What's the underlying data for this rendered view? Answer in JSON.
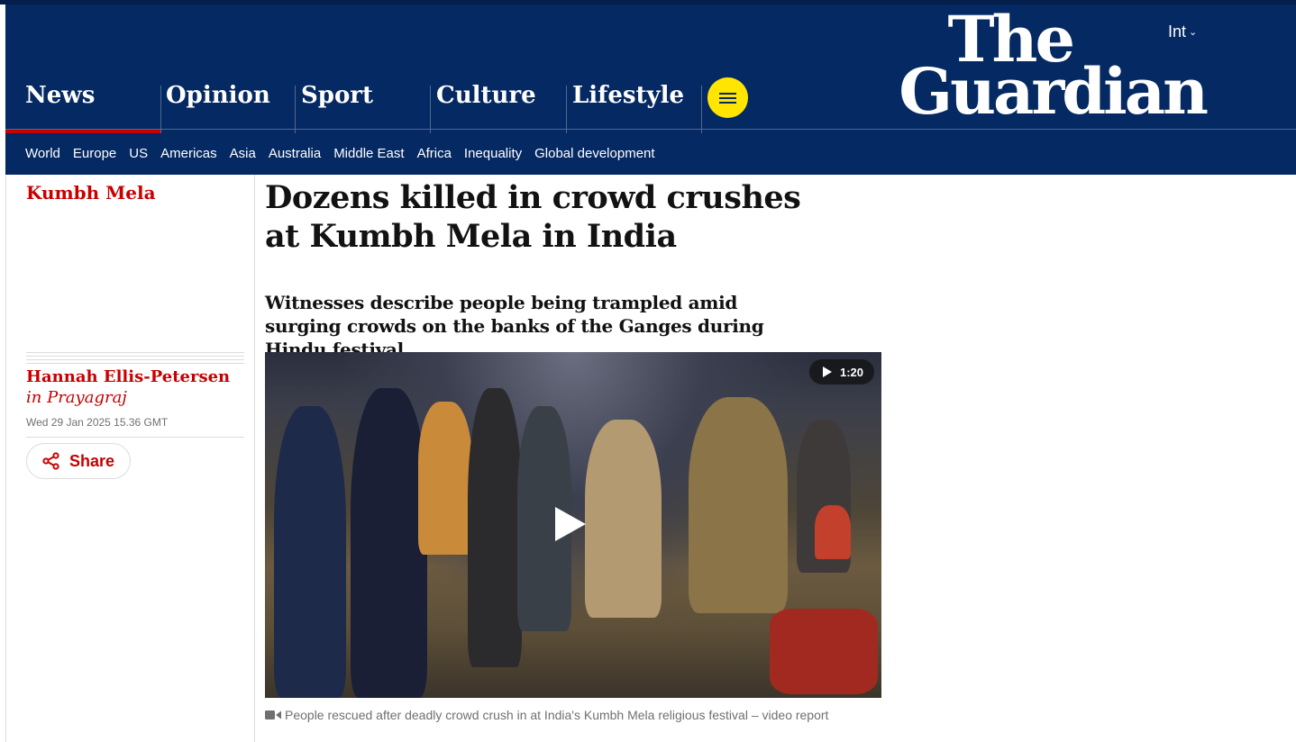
{
  "masthead": {
    "edition": "Int",
    "logo_line1": "The",
    "logo_line2": "Guardian",
    "pillars": [
      {
        "label": "News",
        "active": true
      },
      {
        "label": "Opinion",
        "active": false
      },
      {
        "label": "Sport",
        "active": false
      },
      {
        "label": "Culture",
        "active": false
      },
      {
        "label": "Lifestyle",
        "active": false
      }
    ],
    "subnav": [
      "World",
      "Europe",
      "US",
      "Americas",
      "Asia",
      "Australia",
      "Middle East",
      "Africa",
      "Inequality",
      "Global development"
    ],
    "colors": {
      "brand": "#052962",
      "accent": "#c70000",
      "menu_button": "#ffe500"
    },
    "menu_icon": "hamburger-icon"
  },
  "article": {
    "kicker": "Kumbh Mela",
    "headline": "Dozens killed in crowd crushes at Kumbh Mela in India",
    "standfirst": "Witnesses describe people being trampled amid surging crowds on the banks of the Ganges during Hindu festival",
    "author": "Hannah Ellis-Petersen",
    "author_location_prefix": "in",
    "author_location": "Prayagraj",
    "date": "Wed 29 Jan 2025 15.36 GMT",
    "share_label": "Share",
    "share_icon": "share-icon"
  },
  "video": {
    "duration": "1:20",
    "play_icon": "play-icon",
    "caption": "People rescued after deadly crowd crush in at India's Kumbh Mela religious festival – video report",
    "caption_icon": "video-camera-icon"
  }
}
